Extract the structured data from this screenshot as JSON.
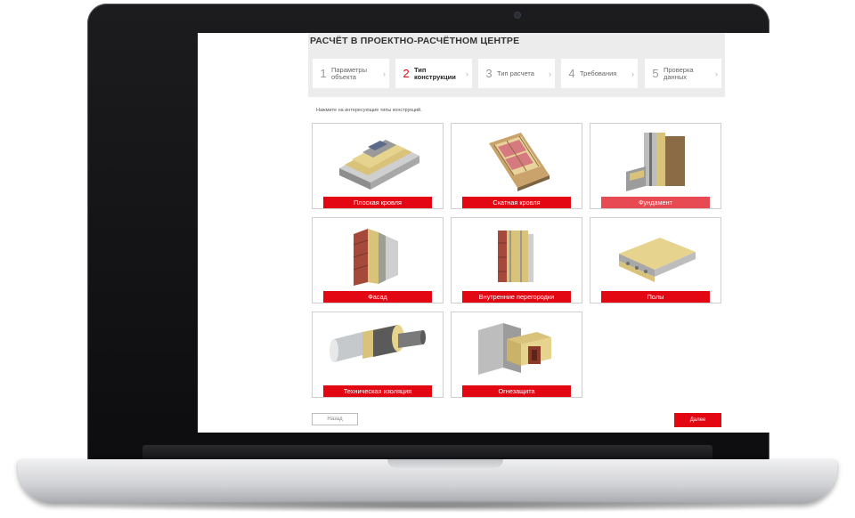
{
  "page": {
    "title": "РАСЧЁТ В ПРОЕКТНО-РАСЧЁТНОМ ЦЕНТРЕ",
    "instruction": "Нажмите на интересующие типы конструкций."
  },
  "steps": [
    {
      "num": "1",
      "label": "Параметры объекта",
      "active": false
    },
    {
      "num": "2",
      "label": "Тип конструкции",
      "active": true
    },
    {
      "num": "3",
      "label": "Тип расчета",
      "active": false
    },
    {
      "num": "4",
      "label": "Требования",
      "active": false
    },
    {
      "num": "5",
      "label": "Проверка данных",
      "active": false
    }
  ],
  "step_arrow": "›",
  "tiles": [
    {
      "label": "Плоская кровля",
      "icon": "flat-roof-illustration"
    },
    {
      "label": "Скатная кровля",
      "icon": "pitched-roof-illustration"
    },
    {
      "label": "Фундамент",
      "icon": "foundation-illustration"
    },
    {
      "label": "Фасад",
      "icon": "facade-illustration"
    },
    {
      "label": "Внутренние перегородки",
      "icon": "partition-illustration"
    },
    {
      "label": "Полы",
      "icon": "floor-illustration"
    },
    {
      "label": "Техническая изоляция",
      "icon": "pipe-insulation-illustration"
    },
    {
      "label": "Огнезащита",
      "icon": "fire-protection-illustration"
    }
  ],
  "nav": {
    "back_label": "Назад",
    "next_label": "Далее"
  },
  "colors": {
    "accent": "#e30613",
    "panel": "#ececec",
    "insulation": "#d9c27a"
  }
}
